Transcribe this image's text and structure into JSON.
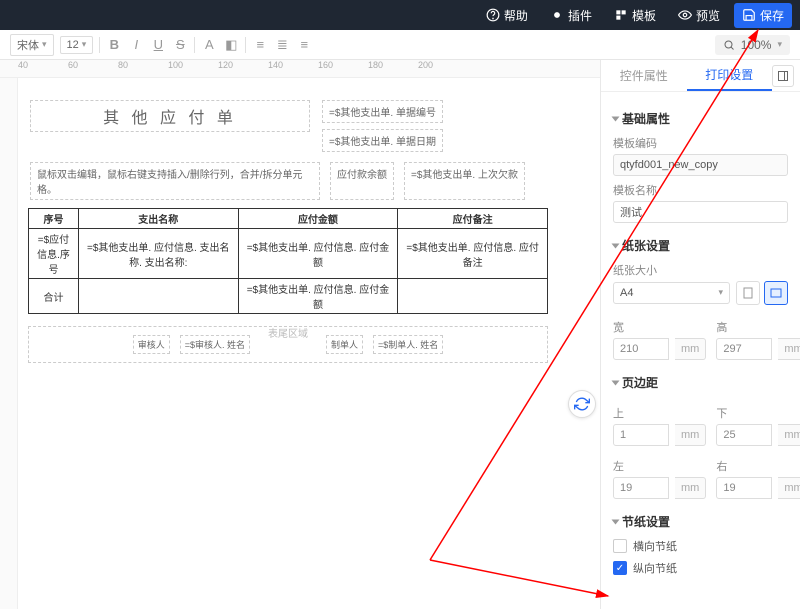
{
  "topbar": {
    "help": "帮助",
    "plugin": "插件",
    "template": "模板",
    "preview": "预览",
    "save": "保存"
  },
  "toolbar": {
    "font": "宋体",
    "size": "12",
    "zoom": "100%"
  },
  "ruler": [
    "40",
    "60",
    "80",
    "100",
    "120",
    "140",
    "160",
    "180",
    "200"
  ],
  "doc": {
    "title": "其 他 应 付 单",
    "headerRight1": "=$其他支出单. 单据编号",
    "headerRight2": "=$其他支出单. 单据日期",
    "hint": "鼠标双击编辑，鼠标右键支持插入/删除行列，合并/拆分单元格。",
    "hint2label": "应付款余额",
    "hint2val": "=$其他支出单. 上次欠款",
    "table": {
      "h1": "序号",
      "h2": "支出名称",
      "h3": "应付金额",
      "h4": "应付备注",
      "r1c1": "=$应付信息.序号",
      "r1c2": "=$其他支出单. 应付信息. 支出名称. 支出名称:",
      "r1c3": "=$其他支出单. 应付信息. 应付金额",
      "r1c4": "=$其他支出单. 应付信息. 应付备注",
      "r2c1": "合计",
      "r2c3": "=$其他支出单. 应付信息. 应付金额"
    },
    "footer": {
      "area": "表尾区域",
      "l1": "审核人",
      "l1v": "=$审核人. 姓名",
      "l2": "制单人",
      "l2v": "=$制单人. 姓名"
    }
  },
  "side": {
    "tab1": "控件属性",
    "tab2": "打印设置",
    "sec1": "基础属性",
    "tplCodeLabel": "模板编码",
    "tplCode": "qtyfd001_new_copy",
    "tplNameLabel": "模板名称",
    "tplName": "测试",
    "sec2": "纸张设置",
    "paperSizeLabel": "纸张大小",
    "paperSize": "A4",
    "widthLabel": "宽",
    "width": "210",
    "heightLabel": "高",
    "height": "297",
    "unit": "mm",
    "sec3": "页边距",
    "top": "上",
    "topV": "1",
    "bottom": "下",
    "bottomV": "25",
    "left": "左",
    "leftV": "19",
    "right": "右",
    "rightV": "19",
    "sec4": "节纸设置",
    "chk1": "横向节纸",
    "chk2": "纵向节纸"
  }
}
